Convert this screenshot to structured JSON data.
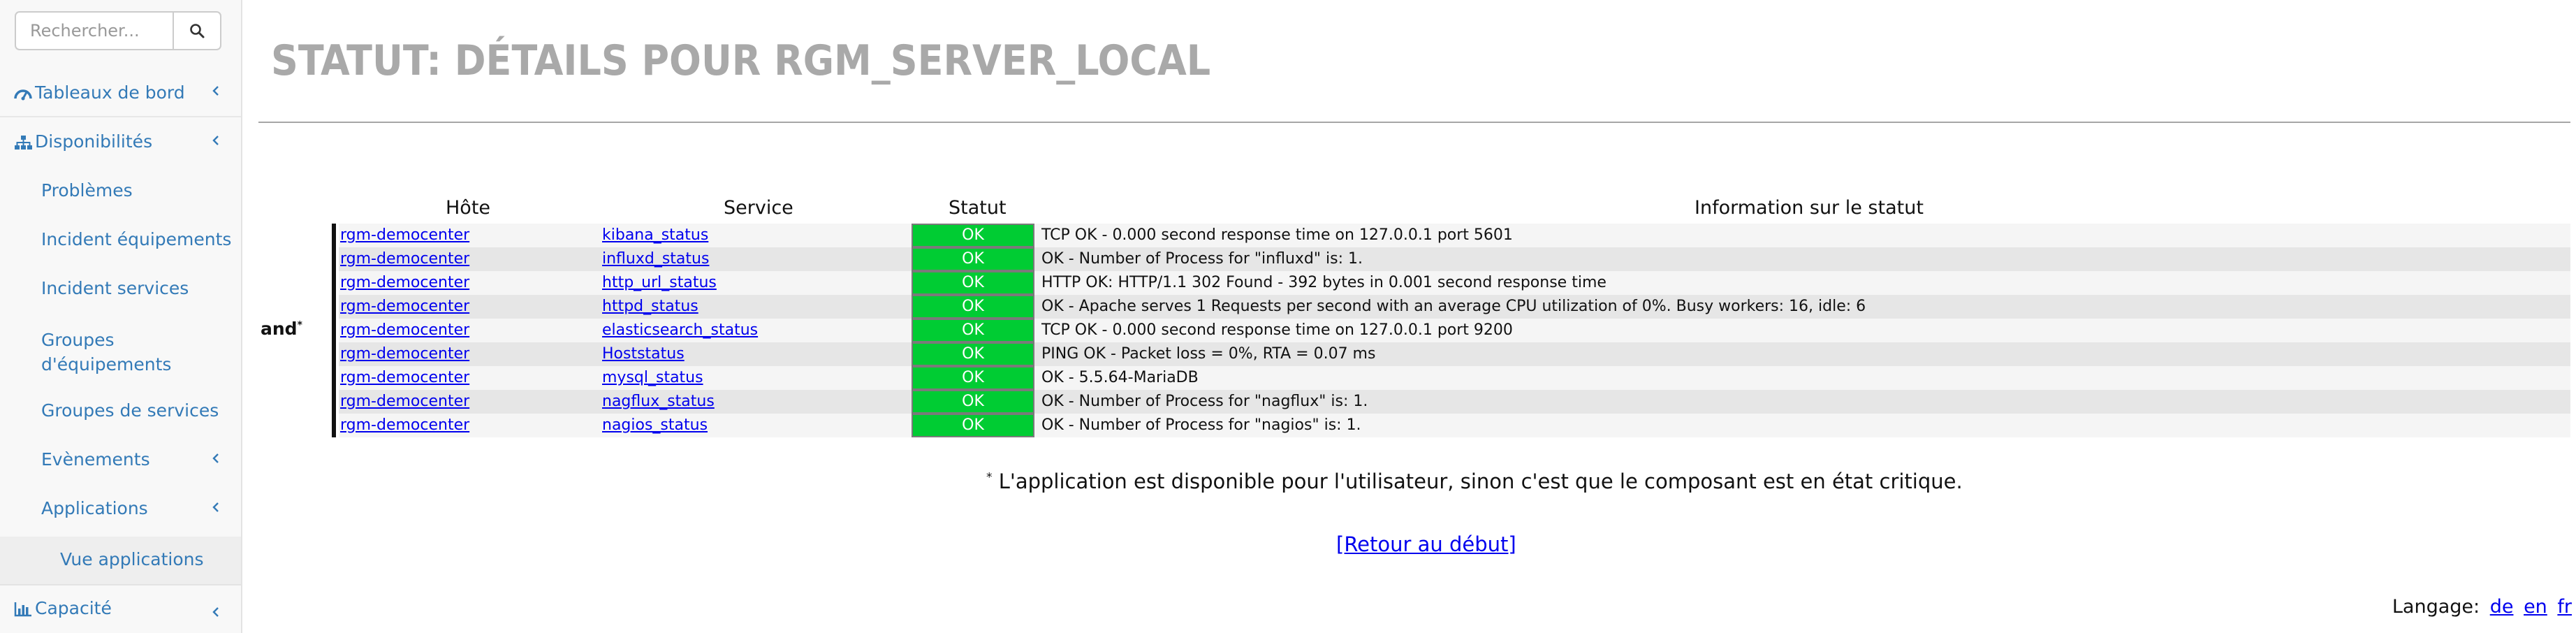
{
  "search": {
    "placeholder": "Rechercher...",
    "value": ""
  },
  "sidebar": {
    "items": [
      {
        "label": "Tableaux de bord"
      },
      {
        "label": "Disponibilités"
      },
      {
        "label": "Problèmes"
      },
      {
        "label": "Incident équipements"
      },
      {
        "label": "Incident services"
      },
      {
        "label_line1": "Groupes",
        "label_line2": "d'équipements"
      },
      {
        "label": "Groupes de services"
      },
      {
        "label": "Evènements"
      },
      {
        "label": "Applications"
      },
      {
        "label": "Vue applications"
      },
      {
        "label": "Capacité"
      }
    ]
  },
  "page": {
    "title": "STATUT: DÉTAILS POUR RGM_SERVER_LOCAL"
  },
  "table": {
    "headers": {
      "host": "Hôte",
      "service": "Service",
      "status": "Statut",
      "info": "Information sur le statut"
    },
    "group_label": "and",
    "group_mark": "*",
    "rows": [
      {
        "host": "rgm-democenter",
        "service": "kibana_status",
        "status": "OK",
        "info": "TCP OK - 0.000 second response time on 127.0.0.1 port 5601"
      },
      {
        "host": "rgm-democenter",
        "service": "influxd_status",
        "status": "OK",
        "info": "OK - Number of Process for \"influxd\" is: 1."
      },
      {
        "host": "rgm-democenter",
        "service": "http_url_status",
        "status": "OK",
        "info": "HTTP OK: HTTP/1.1 302 Found - 392 bytes in 0.001 second response time"
      },
      {
        "host": "rgm-democenter",
        "service": "httpd_status",
        "status": "OK",
        "info": "OK - Apache serves 1 Requests per second with an average CPU utilization of 0%. Busy workers: 16, idle: 6"
      },
      {
        "host": "rgm-democenter",
        "service": "elasticsearch_status",
        "status": "OK",
        "info": "TCP OK - 0.000 second response time on 127.0.0.1 port 9200"
      },
      {
        "host": "rgm-democenter",
        "service": "Hoststatus",
        "status": "OK",
        "info": "PING OK - Packet loss = 0%, RTA = 0.07 ms"
      },
      {
        "host": "rgm-democenter",
        "service": "mysql_status",
        "status": "OK",
        "info": "OK - 5.5.64-MariaDB"
      },
      {
        "host": "rgm-democenter",
        "service": "nagflux_status",
        "status": "OK",
        "info": "OK - Number of Process for \"nagflux\" is: 1."
      },
      {
        "host": "rgm-democenter",
        "service": "nagios_status",
        "status": "OK",
        "info": "OK - Number of Process for \"nagios\" is: 1."
      }
    ]
  },
  "footnote": {
    "mark": "*",
    "text": "L'application est disponible pour l'utilisateur, sinon c'est que le composant est en état critique."
  },
  "back_link": "[Retour au début]",
  "language": {
    "label": "Langage:",
    "options": [
      "de",
      "en",
      "fr"
    ]
  },
  "colors": {
    "ok": "#00cc33",
    "link": "#337ab7",
    "title": "#a9a9a9"
  }
}
